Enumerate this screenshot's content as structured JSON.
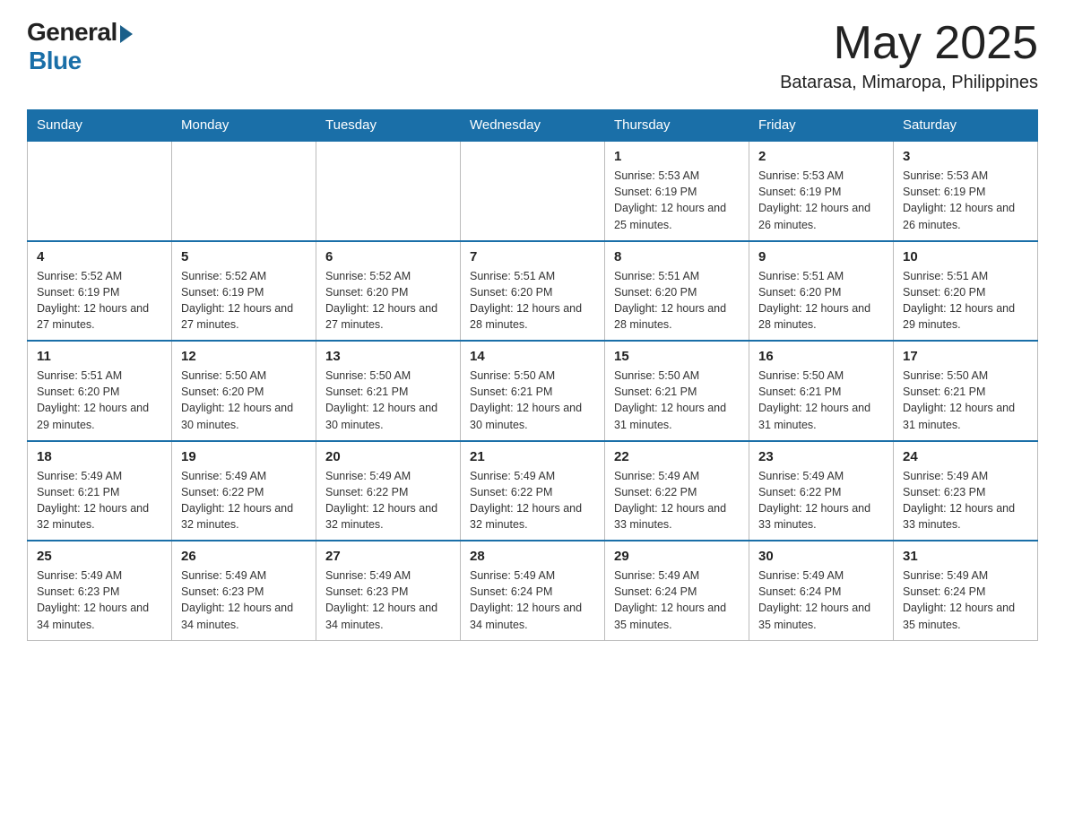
{
  "header": {
    "logo_general": "General",
    "logo_blue": "Blue",
    "month": "May 2025",
    "location": "Batarasa, Mimaropa, Philippines"
  },
  "weekdays": [
    "Sunday",
    "Monday",
    "Tuesday",
    "Wednesday",
    "Thursday",
    "Friday",
    "Saturday"
  ],
  "weeks": [
    [
      {
        "day": "",
        "info": ""
      },
      {
        "day": "",
        "info": ""
      },
      {
        "day": "",
        "info": ""
      },
      {
        "day": "",
        "info": ""
      },
      {
        "day": "1",
        "info": "Sunrise: 5:53 AM\nSunset: 6:19 PM\nDaylight: 12 hours and 25 minutes."
      },
      {
        "day": "2",
        "info": "Sunrise: 5:53 AM\nSunset: 6:19 PM\nDaylight: 12 hours and 26 minutes."
      },
      {
        "day": "3",
        "info": "Sunrise: 5:53 AM\nSunset: 6:19 PM\nDaylight: 12 hours and 26 minutes."
      }
    ],
    [
      {
        "day": "4",
        "info": "Sunrise: 5:52 AM\nSunset: 6:19 PM\nDaylight: 12 hours and 27 minutes."
      },
      {
        "day": "5",
        "info": "Sunrise: 5:52 AM\nSunset: 6:19 PM\nDaylight: 12 hours and 27 minutes."
      },
      {
        "day": "6",
        "info": "Sunrise: 5:52 AM\nSunset: 6:20 PM\nDaylight: 12 hours and 27 minutes."
      },
      {
        "day": "7",
        "info": "Sunrise: 5:51 AM\nSunset: 6:20 PM\nDaylight: 12 hours and 28 minutes."
      },
      {
        "day": "8",
        "info": "Sunrise: 5:51 AM\nSunset: 6:20 PM\nDaylight: 12 hours and 28 minutes."
      },
      {
        "day": "9",
        "info": "Sunrise: 5:51 AM\nSunset: 6:20 PM\nDaylight: 12 hours and 28 minutes."
      },
      {
        "day": "10",
        "info": "Sunrise: 5:51 AM\nSunset: 6:20 PM\nDaylight: 12 hours and 29 minutes."
      }
    ],
    [
      {
        "day": "11",
        "info": "Sunrise: 5:51 AM\nSunset: 6:20 PM\nDaylight: 12 hours and 29 minutes."
      },
      {
        "day": "12",
        "info": "Sunrise: 5:50 AM\nSunset: 6:20 PM\nDaylight: 12 hours and 30 minutes."
      },
      {
        "day": "13",
        "info": "Sunrise: 5:50 AM\nSunset: 6:21 PM\nDaylight: 12 hours and 30 minutes."
      },
      {
        "day": "14",
        "info": "Sunrise: 5:50 AM\nSunset: 6:21 PM\nDaylight: 12 hours and 30 minutes."
      },
      {
        "day": "15",
        "info": "Sunrise: 5:50 AM\nSunset: 6:21 PM\nDaylight: 12 hours and 31 minutes."
      },
      {
        "day": "16",
        "info": "Sunrise: 5:50 AM\nSunset: 6:21 PM\nDaylight: 12 hours and 31 minutes."
      },
      {
        "day": "17",
        "info": "Sunrise: 5:50 AM\nSunset: 6:21 PM\nDaylight: 12 hours and 31 minutes."
      }
    ],
    [
      {
        "day": "18",
        "info": "Sunrise: 5:49 AM\nSunset: 6:21 PM\nDaylight: 12 hours and 32 minutes."
      },
      {
        "day": "19",
        "info": "Sunrise: 5:49 AM\nSunset: 6:22 PM\nDaylight: 12 hours and 32 minutes."
      },
      {
        "day": "20",
        "info": "Sunrise: 5:49 AM\nSunset: 6:22 PM\nDaylight: 12 hours and 32 minutes."
      },
      {
        "day": "21",
        "info": "Sunrise: 5:49 AM\nSunset: 6:22 PM\nDaylight: 12 hours and 32 minutes."
      },
      {
        "day": "22",
        "info": "Sunrise: 5:49 AM\nSunset: 6:22 PM\nDaylight: 12 hours and 33 minutes."
      },
      {
        "day": "23",
        "info": "Sunrise: 5:49 AM\nSunset: 6:22 PM\nDaylight: 12 hours and 33 minutes."
      },
      {
        "day": "24",
        "info": "Sunrise: 5:49 AM\nSunset: 6:23 PM\nDaylight: 12 hours and 33 minutes."
      }
    ],
    [
      {
        "day": "25",
        "info": "Sunrise: 5:49 AM\nSunset: 6:23 PM\nDaylight: 12 hours and 34 minutes."
      },
      {
        "day": "26",
        "info": "Sunrise: 5:49 AM\nSunset: 6:23 PM\nDaylight: 12 hours and 34 minutes."
      },
      {
        "day": "27",
        "info": "Sunrise: 5:49 AM\nSunset: 6:23 PM\nDaylight: 12 hours and 34 minutes."
      },
      {
        "day": "28",
        "info": "Sunrise: 5:49 AM\nSunset: 6:24 PM\nDaylight: 12 hours and 34 minutes."
      },
      {
        "day": "29",
        "info": "Sunrise: 5:49 AM\nSunset: 6:24 PM\nDaylight: 12 hours and 35 minutes."
      },
      {
        "day": "30",
        "info": "Sunrise: 5:49 AM\nSunset: 6:24 PM\nDaylight: 12 hours and 35 minutes."
      },
      {
        "day": "31",
        "info": "Sunrise: 5:49 AM\nSunset: 6:24 PM\nDaylight: 12 hours and 35 minutes."
      }
    ]
  ]
}
